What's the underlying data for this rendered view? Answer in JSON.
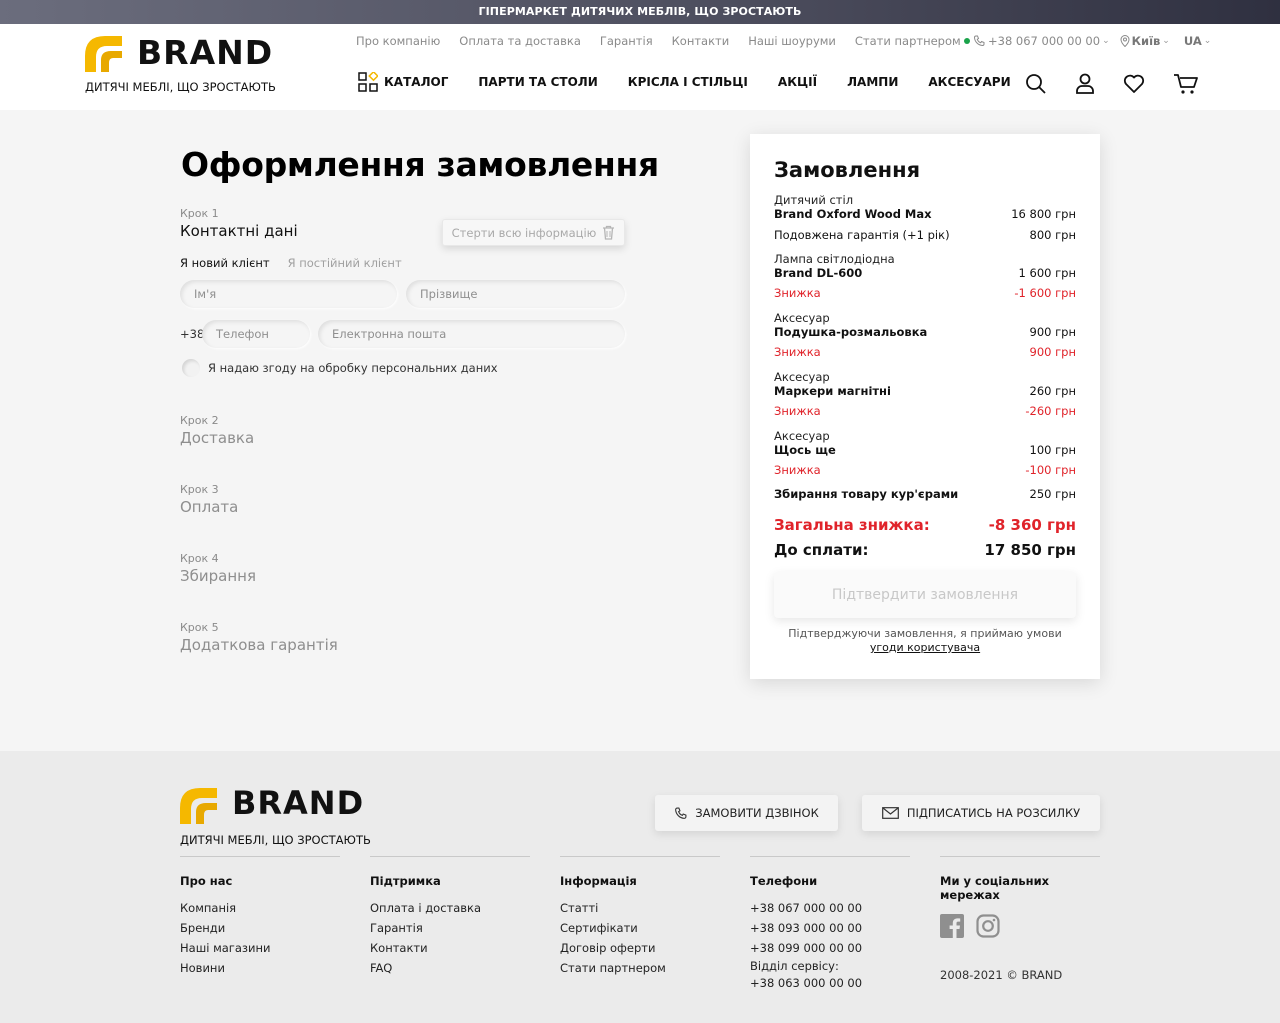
{
  "topbar": {
    "text": "ГІПЕРМАРКЕТ ДИТЯЧИХ МЕБЛІВ, ЩО ЗРОСТАЮТЬ"
  },
  "brand": {
    "name": "BRAND",
    "tagline": "ДИТЯЧІ МЕБЛІ, ЩО ЗРОСТАЮТЬ",
    "accent": "#f5b800"
  },
  "header": {
    "subnav": [
      "Про компанію",
      "Оплата та доставка",
      "Гарантія",
      "Контакти",
      "Наші шоуруми",
      "Стати партнером"
    ],
    "phone": "+38 067 000 00 00",
    "city": "Київ",
    "lang": "UA",
    "catalog_label": "КАТАЛОГ",
    "mainnav": [
      "ПАРТИ ТА СТОЛИ",
      "КРІСЛА І СТІЛЬЦІ",
      "АКЦІЇ",
      "ЛАМПИ",
      "АКСЕСУАРИ"
    ]
  },
  "checkout": {
    "title": "Оформлення замовлення",
    "step1": {
      "num": "Крок 1",
      "title": "Контактні дані"
    },
    "clear_label": "Стерти всю інформацію",
    "tab_new": "Я новий клієнт",
    "tab_existing": "Я постійний клієнт",
    "first_name_placeholder": "Ім'я",
    "last_name_placeholder": "Прізвище",
    "phone_prefix": "+38",
    "phone_placeholder": "Телефон",
    "email_placeholder": "Електронна пошта",
    "consent_label": "Я надаю згоду на обробку персональних даних",
    "steps": [
      {
        "num": "Крок 2",
        "title": "Доставка"
      },
      {
        "num": "Крок 3",
        "title": "Оплата"
      },
      {
        "num": "Крок 4",
        "title": "Збирання"
      },
      {
        "num": "Крок 5",
        "title": "Додаткова гарантія"
      }
    ]
  },
  "order": {
    "title": "Замовлення",
    "item1": {
      "cat": "Дитячий стіл",
      "name": "Brand Oxford Wood Max",
      "price": "16 800 грн"
    },
    "warranty": {
      "name": "Подовжена гарантія (+1 рік)",
      "price": "800 грн"
    },
    "item2": {
      "cat": "Лампа світлодіодна",
      "name": "Brand DL-600",
      "price": "1 600 грн",
      "disc_label": "Знижка",
      "disc": "-1 600 грн"
    },
    "item3": {
      "cat": "Аксесуар",
      "name": "Подушка-розмальовка",
      "price": "900 грн",
      "disc_label": "Знижка",
      "disc": "900 грн"
    },
    "item4": {
      "cat": "Аксесуар",
      "name": "Маркери магнітні",
      "price": "260 грн",
      "disc_label": "Знижка",
      "disc": "-260 грн"
    },
    "item5": {
      "cat": "Аксесуар",
      "name": "Щось ще",
      "price": "100 грн",
      "disc_label": "Знижка",
      "disc": "-100 грн"
    },
    "assembly": {
      "name": "Збирання товару кур'єрами",
      "price": "250 грн"
    },
    "total_discount_label": "Загальна знижка:",
    "total_discount": "-8 360 грн",
    "to_pay_label": "До сплати:",
    "to_pay": "17 850 грн",
    "confirm_label": "Підтвердити замовлення",
    "terms_text": "Підтверджуючи замовлення, я приймаю умови",
    "terms_link": "угоди користувача",
    "discount_color": "#e0232a"
  },
  "footer": {
    "call_label": "ЗАМОВИТИ ДЗВІНОК",
    "subscribe_label": "ПІДПИСАТИСЬ НА РОЗСИЛКУ",
    "col1": {
      "title": "Про нас",
      "links": [
        "Компанія",
        "Бренди",
        "Наші магазини",
        "Новини"
      ]
    },
    "col2": {
      "title": "Підтримка",
      "links": [
        "Оплата і доставка",
        "Гарантія",
        "Контакти",
        "FAQ"
      ]
    },
    "col3": {
      "title": "Інформація",
      "links": [
        "Статті",
        "Сертифікати",
        "Договір оферти",
        "Стати партнером"
      ]
    },
    "col4": {
      "title": "Телефони",
      "links": [
        "+38 067 000 00 00",
        "+38 093 000 00 00",
        "+38 099 000 00 00"
      ],
      "service_label": "Відділ сервісу:",
      "service_phone": "+38 063 000 00 00"
    },
    "col5": {
      "title": "Ми у соціальних мережах",
      "copyright": "2008-2021 © BRAND"
    }
  }
}
